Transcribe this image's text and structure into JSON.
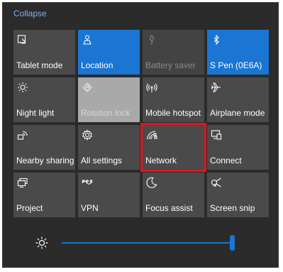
{
  "header": {
    "collapse_label": "Collapse"
  },
  "colors": {
    "accent": "#1a76d2",
    "tile": "#4a4a4a",
    "highlight": "#e0141b"
  },
  "tiles": [
    {
      "label": "Tablet mode",
      "icon": "tablet-mode-icon",
      "state": "default"
    },
    {
      "label": "Location",
      "icon": "location-icon",
      "state": "on"
    },
    {
      "label": "Battery saver",
      "icon": "battery-saver-icon",
      "state": "off"
    },
    {
      "label": "S Pen (0E6A)",
      "icon": "bluetooth-icon",
      "state": "on"
    },
    {
      "label": "Night light",
      "icon": "night-light-icon",
      "state": "default"
    },
    {
      "label": "Rotation lock",
      "icon": "rotation-lock-icon",
      "state": "dim"
    },
    {
      "label": "Mobile hotspot",
      "icon": "mobile-hotspot-icon",
      "state": "default"
    },
    {
      "label": "Airplane mode",
      "icon": "airplane-icon",
      "state": "default"
    },
    {
      "label": "Nearby sharing",
      "icon": "nearby-sharing-icon",
      "state": "default"
    },
    {
      "label": "All settings",
      "icon": "gear-icon",
      "state": "default"
    },
    {
      "label": "Network",
      "icon": "network-icon",
      "state": "highlighted"
    },
    {
      "label": "Connect",
      "icon": "connect-icon",
      "state": "default"
    },
    {
      "label": "Project",
      "icon": "project-icon",
      "state": "default"
    },
    {
      "label": "VPN",
      "icon": "vpn-icon",
      "state": "default"
    },
    {
      "label": "Focus assist",
      "icon": "moon-icon",
      "state": "default"
    },
    {
      "label": "Screen snip",
      "icon": "screen-snip-icon",
      "state": "default"
    }
  ],
  "brightness": {
    "icon": "brightness-icon",
    "level": 1.0
  }
}
